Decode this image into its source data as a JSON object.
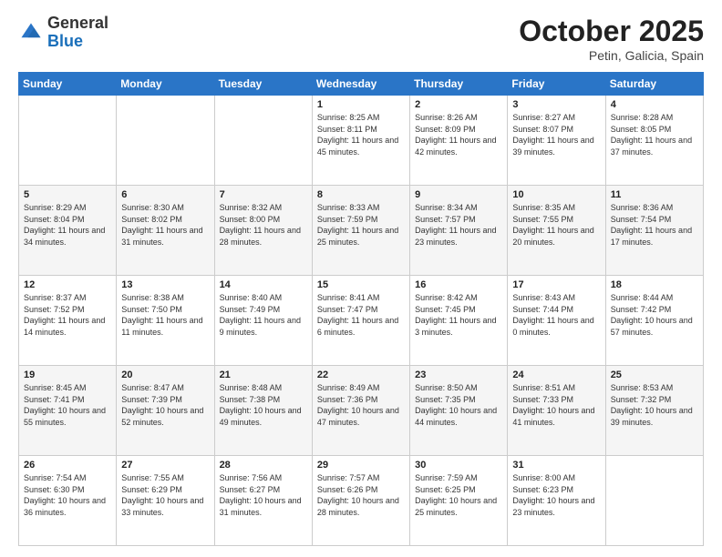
{
  "header": {
    "logo_general": "General",
    "logo_blue": "Blue",
    "title": "October 2025",
    "subtitle": "Petin, Galicia, Spain"
  },
  "weekdays": [
    "Sunday",
    "Monday",
    "Tuesday",
    "Wednesday",
    "Thursday",
    "Friday",
    "Saturday"
  ],
  "weeks": [
    [
      {
        "day": "",
        "sunrise": "",
        "sunset": "",
        "daylight": ""
      },
      {
        "day": "",
        "sunrise": "",
        "sunset": "",
        "daylight": ""
      },
      {
        "day": "",
        "sunrise": "",
        "sunset": "",
        "daylight": ""
      },
      {
        "day": "1",
        "sunrise": "8:25 AM",
        "sunset": "8:11 PM",
        "daylight": "11 hours and 45 minutes."
      },
      {
        "day": "2",
        "sunrise": "8:26 AM",
        "sunset": "8:09 PM",
        "daylight": "11 hours and 42 minutes."
      },
      {
        "day": "3",
        "sunrise": "8:27 AM",
        "sunset": "8:07 PM",
        "daylight": "11 hours and 39 minutes."
      },
      {
        "day": "4",
        "sunrise": "8:28 AM",
        "sunset": "8:05 PM",
        "daylight": "11 hours and 37 minutes."
      }
    ],
    [
      {
        "day": "5",
        "sunrise": "8:29 AM",
        "sunset": "8:04 PM",
        "daylight": "11 hours and 34 minutes."
      },
      {
        "day": "6",
        "sunrise": "8:30 AM",
        "sunset": "8:02 PM",
        "daylight": "11 hours and 31 minutes."
      },
      {
        "day": "7",
        "sunrise": "8:32 AM",
        "sunset": "8:00 PM",
        "daylight": "11 hours and 28 minutes."
      },
      {
        "day": "8",
        "sunrise": "8:33 AM",
        "sunset": "7:59 PM",
        "daylight": "11 hours and 25 minutes."
      },
      {
        "day": "9",
        "sunrise": "8:34 AM",
        "sunset": "7:57 PM",
        "daylight": "11 hours and 23 minutes."
      },
      {
        "day": "10",
        "sunrise": "8:35 AM",
        "sunset": "7:55 PM",
        "daylight": "11 hours and 20 minutes."
      },
      {
        "day": "11",
        "sunrise": "8:36 AM",
        "sunset": "7:54 PM",
        "daylight": "11 hours and 17 minutes."
      }
    ],
    [
      {
        "day": "12",
        "sunrise": "8:37 AM",
        "sunset": "7:52 PM",
        "daylight": "11 hours and 14 minutes."
      },
      {
        "day": "13",
        "sunrise": "8:38 AM",
        "sunset": "7:50 PM",
        "daylight": "11 hours and 11 minutes."
      },
      {
        "day": "14",
        "sunrise": "8:40 AM",
        "sunset": "7:49 PM",
        "daylight": "11 hours and 9 minutes."
      },
      {
        "day": "15",
        "sunrise": "8:41 AM",
        "sunset": "7:47 PM",
        "daylight": "11 hours and 6 minutes."
      },
      {
        "day": "16",
        "sunrise": "8:42 AM",
        "sunset": "7:45 PM",
        "daylight": "11 hours and 3 minutes."
      },
      {
        "day": "17",
        "sunrise": "8:43 AM",
        "sunset": "7:44 PM",
        "daylight": "11 hours and 0 minutes."
      },
      {
        "day": "18",
        "sunrise": "8:44 AM",
        "sunset": "7:42 PM",
        "daylight": "10 hours and 57 minutes."
      }
    ],
    [
      {
        "day": "19",
        "sunrise": "8:45 AM",
        "sunset": "7:41 PM",
        "daylight": "10 hours and 55 minutes."
      },
      {
        "day": "20",
        "sunrise": "8:47 AM",
        "sunset": "7:39 PM",
        "daylight": "10 hours and 52 minutes."
      },
      {
        "day": "21",
        "sunrise": "8:48 AM",
        "sunset": "7:38 PM",
        "daylight": "10 hours and 49 minutes."
      },
      {
        "day": "22",
        "sunrise": "8:49 AM",
        "sunset": "7:36 PM",
        "daylight": "10 hours and 47 minutes."
      },
      {
        "day": "23",
        "sunrise": "8:50 AM",
        "sunset": "7:35 PM",
        "daylight": "10 hours and 44 minutes."
      },
      {
        "day": "24",
        "sunrise": "8:51 AM",
        "sunset": "7:33 PM",
        "daylight": "10 hours and 41 minutes."
      },
      {
        "day": "25",
        "sunrise": "8:53 AM",
        "sunset": "7:32 PM",
        "daylight": "10 hours and 39 minutes."
      }
    ],
    [
      {
        "day": "26",
        "sunrise": "7:54 AM",
        "sunset": "6:30 PM",
        "daylight": "10 hours and 36 minutes."
      },
      {
        "day": "27",
        "sunrise": "7:55 AM",
        "sunset": "6:29 PM",
        "daylight": "10 hours and 33 minutes."
      },
      {
        "day": "28",
        "sunrise": "7:56 AM",
        "sunset": "6:27 PM",
        "daylight": "10 hours and 31 minutes."
      },
      {
        "day": "29",
        "sunrise": "7:57 AM",
        "sunset": "6:26 PM",
        "daylight": "10 hours and 28 minutes."
      },
      {
        "day": "30",
        "sunrise": "7:59 AM",
        "sunset": "6:25 PM",
        "daylight": "10 hours and 25 minutes."
      },
      {
        "day": "31",
        "sunrise": "8:00 AM",
        "sunset": "6:23 PM",
        "daylight": "10 hours and 23 minutes."
      },
      {
        "day": "",
        "sunrise": "",
        "sunset": "",
        "daylight": ""
      }
    ]
  ]
}
